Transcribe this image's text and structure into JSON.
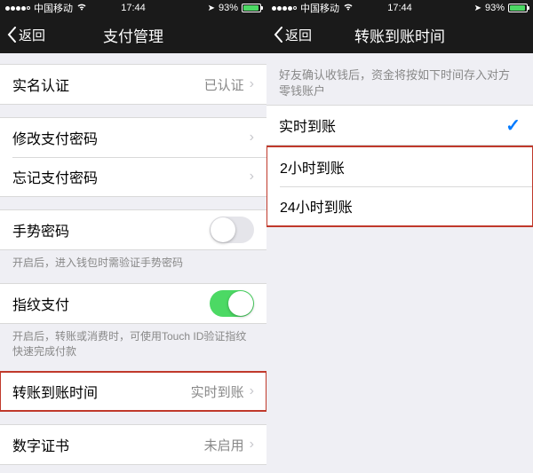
{
  "status": {
    "carrier": "中国移动",
    "time": "17:44",
    "battery_pct": "93%"
  },
  "left": {
    "back": "返回",
    "title": "支付管理",
    "rows": {
      "realname": {
        "label": "实名认证",
        "value": "已认证"
      },
      "change_pwd": {
        "label": "修改支付密码"
      },
      "forgot_pwd": {
        "label": "忘记支付密码"
      },
      "gesture_pwd": {
        "label": "手势密码"
      },
      "gesture_hint": "开启后，进入钱包时需验证手势密码",
      "fingerprint": {
        "label": "指纹支付"
      },
      "fingerprint_hint": "开启后，转账或消费时，可使用Touch ID验证指纹快速完成付款",
      "transfer_time": {
        "label": "转账到账时间",
        "value": "实时到账"
      },
      "cert": {
        "label": "数字证书",
        "value": "未启用"
      }
    }
  },
  "right": {
    "back": "返回",
    "title": "转账到账时间",
    "hint": "好友确认收钱后，资金将按如下时间存入对方零钱账户",
    "options": {
      "instant": "实时到账",
      "two_hours": "2小时到账",
      "twenty_four": "24小时到账"
    }
  }
}
